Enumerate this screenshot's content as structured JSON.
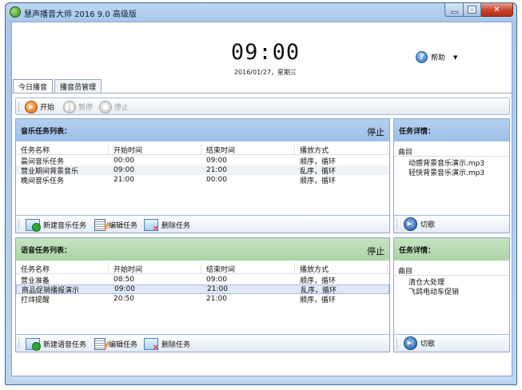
{
  "window": {
    "title": "慧声播音大师 2016 9.0 高级版"
  },
  "clock": {
    "time": "09:00",
    "date": "2016/01/27，星期三"
  },
  "help": {
    "label": "帮助",
    "dropdown": "▼"
  },
  "tabs": [
    {
      "label": "今日播音"
    },
    {
      "label": "播音员管理"
    }
  ],
  "toolbar": {
    "start": "开始",
    "pause": "暂停",
    "stop": "停止"
  },
  "music": {
    "title": "音乐任务列表：",
    "status": "停止",
    "columns": [
      "任务名称",
      "开始时间",
      "结束时间",
      "播放方式"
    ],
    "rows": [
      [
        "晨间音乐任务",
        "00:00",
        "09:00",
        "顺序，循环"
      ],
      [
        "营业期间背景音乐",
        "09:00",
        "21:00",
        "乱序，循环"
      ],
      [
        "晚间音乐任务",
        "21:00",
        "00:00",
        "顺序，循环"
      ]
    ],
    "footer": {
      "new": "新建音乐任务",
      "edit": "编辑任务",
      "delete": "删除任务"
    },
    "details": {
      "title": "任务详情：",
      "header": "曲目",
      "items": [
        "动感背景音乐演示.mp3",
        "轻快背景音乐演示.mp3"
      ],
      "next": "切歌"
    }
  },
  "voice": {
    "title": "语音任务列表：",
    "status": "停止",
    "columns": [
      "任务名称",
      "开始时间",
      "结束时间",
      "播放方式"
    ],
    "rows": [
      [
        "营业准备",
        "08:50",
        "09:00",
        "顺序，循环"
      ],
      [
        "商品促销播报演示",
        "09:00",
        "21:00",
        "乱序，循环"
      ],
      [
        "打烊提醒",
        "20:50",
        "21:00",
        "顺序，循环"
      ]
    ],
    "footer": {
      "new": "新建语音任务",
      "edit": "编辑任务",
      "delete": "删除任务"
    },
    "details": {
      "title": "任务详情：",
      "header": "曲目",
      "items": [
        "清仓大处理",
        "飞鸽电动车促销"
      ],
      "next": "切歌"
    }
  }
}
